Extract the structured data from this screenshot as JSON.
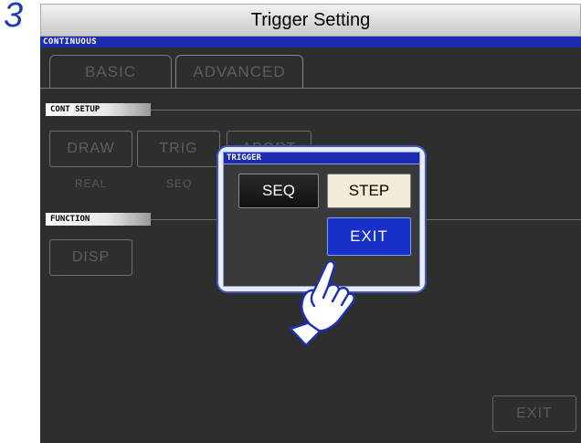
{
  "step_number": "3",
  "title": "Trigger Setting",
  "mode": "CONTINUOUS",
  "tabs": [
    {
      "label": "BASIC"
    },
    {
      "label": "ADVANCED"
    }
  ],
  "sections": {
    "cont_setup": "CONT SETUP",
    "function": "FUNCTION"
  },
  "cont_setup_buttons": [
    {
      "label": "DRAW",
      "sub": "REAL"
    },
    {
      "label": "TRIG",
      "sub": "SEQ"
    },
    {
      "label": "ABORT"
    }
  ],
  "function_buttons": [
    {
      "label": "DISP"
    }
  ],
  "popup": {
    "title": "TRIGGER",
    "seq_label": "SEQ",
    "step_label": "STEP",
    "exit_label": "EXIT",
    "selected": "STEP"
  },
  "bottom_exit_label": "EXIT",
  "icons": {
    "pointer": "pointing-hand-icon"
  }
}
